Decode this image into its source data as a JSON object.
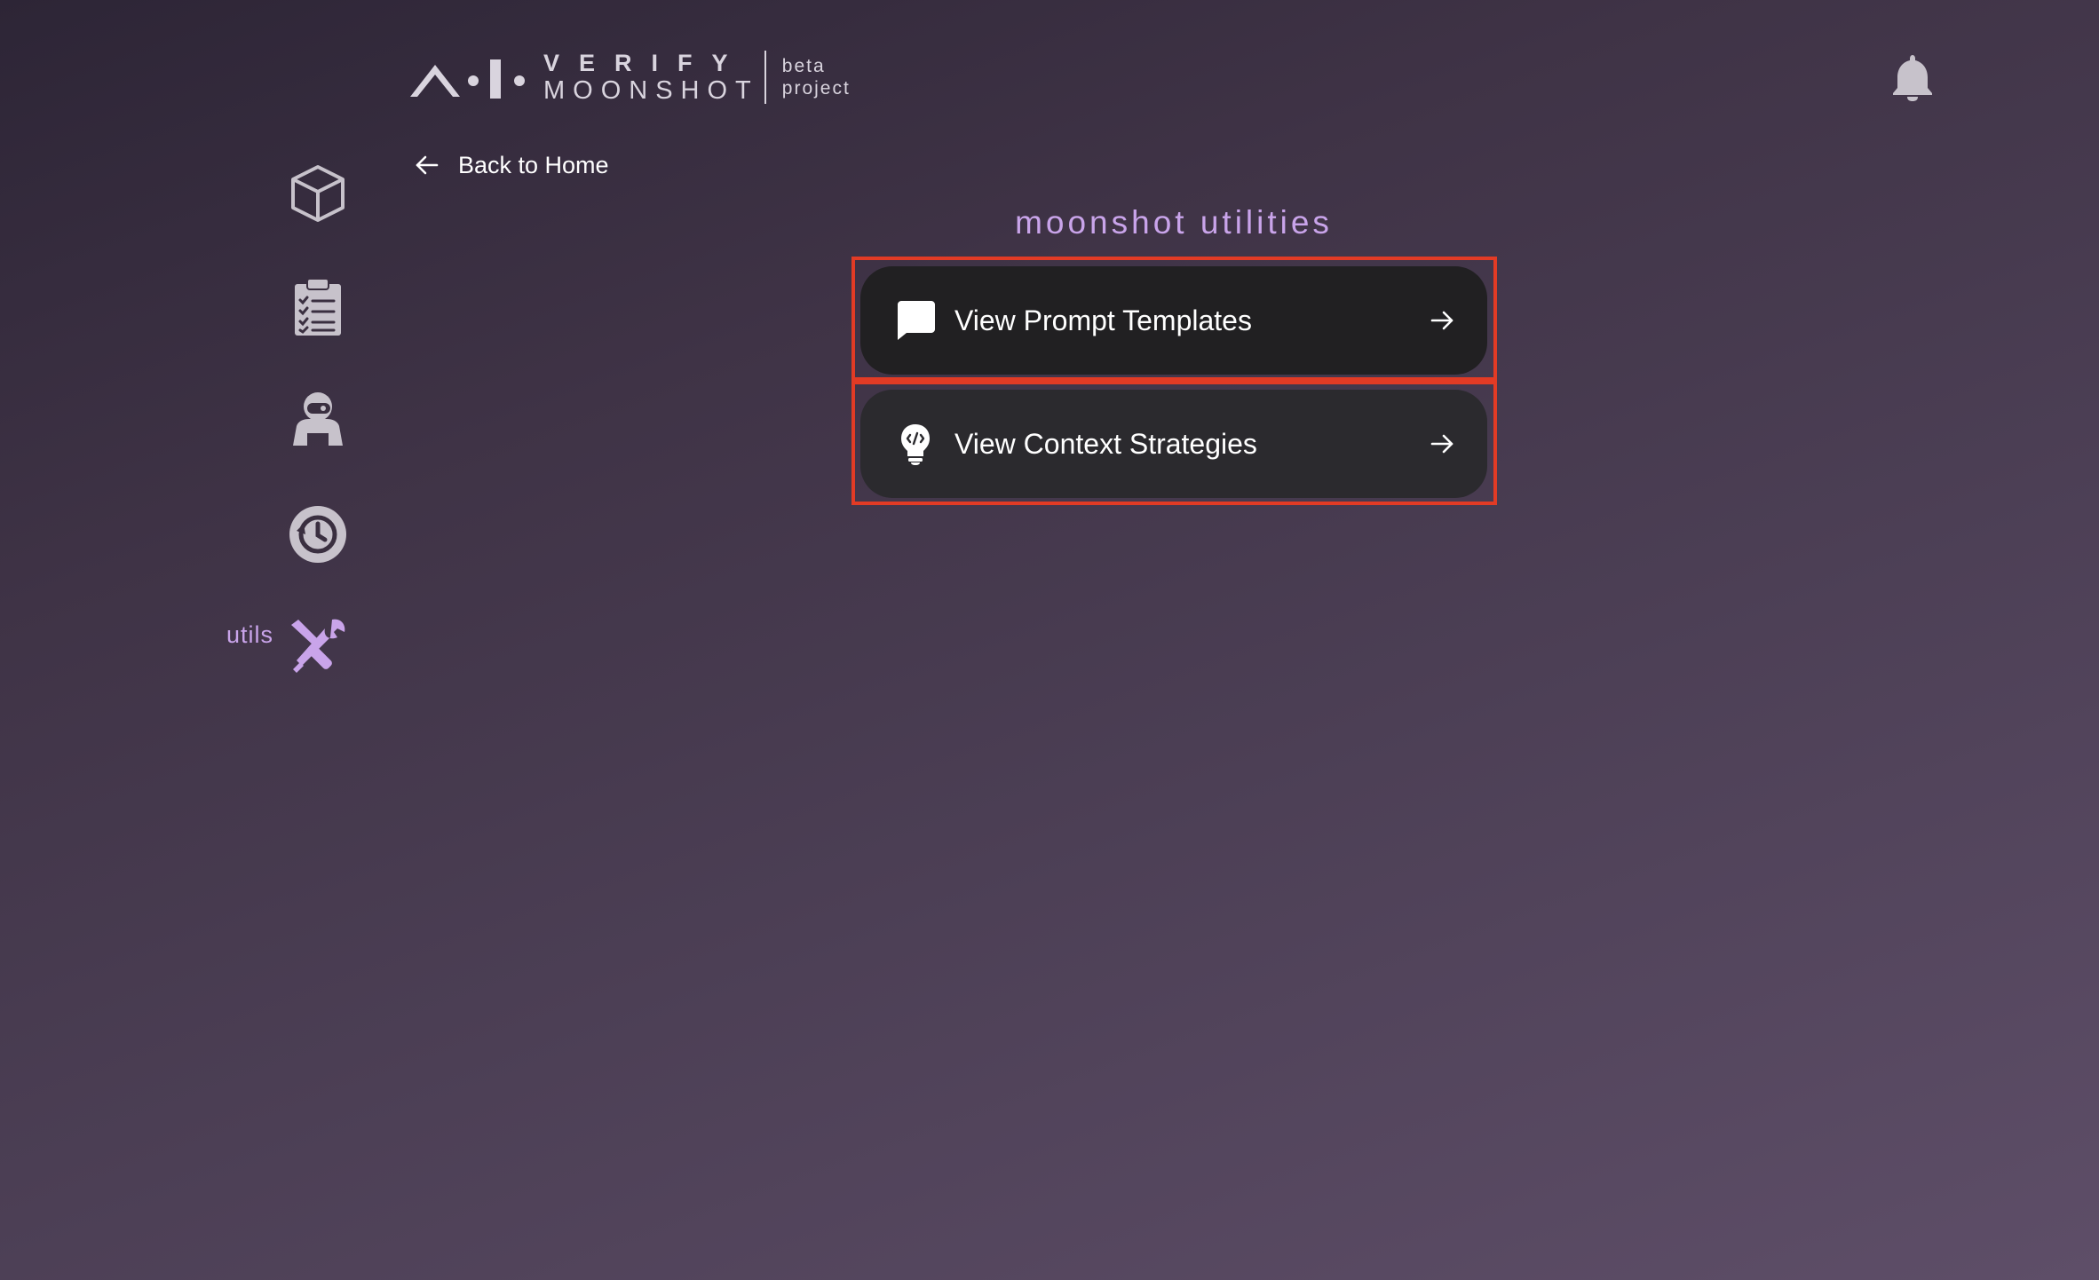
{
  "header": {
    "logo_verify": "VERIFY",
    "logo_moonshot": "MOONSHOT",
    "logo_tag_line1": "beta",
    "logo_tag_line2": "project",
    "notification_icon": "bell-icon"
  },
  "sidebar": {
    "items": [
      {
        "icon": "cube-icon",
        "label": ""
      },
      {
        "icon": "clipboard-checklist-icon",
        "label": ""
      },
      {
        "icon": "red-team-agent-icon",
        "label": ""
      },
      {
        "icon": "history-icon",
        "label": ""
      },
      {
        "icon": "tools-icon",
        "label": "utils",
        "active": true
      }
    ]
  },
  "back_link": {
    "label": "Back to Home",
    "icon": "arrow-left-icon"
  },
  "main": {
    "title": "moonshot utilities",
    "cards": [
      {
        "label": "View Prompt Templates",
        "icon": "chat-bubble-icon",
        "arrow": "arrow-right-icon"
      },
      {
        "label": "View Context Strategies",
        "icon": "lightbulb-code-icon",
        "arrow": "arrow-right-icon"
      }
    ]
  },
  "colors": {
    "accent": "#c9a4ea",
    "highlight_outline": "#e23b25",
    "card_background": "#212022",
    "icon_gray": "#c7c2cb"
  }
}
